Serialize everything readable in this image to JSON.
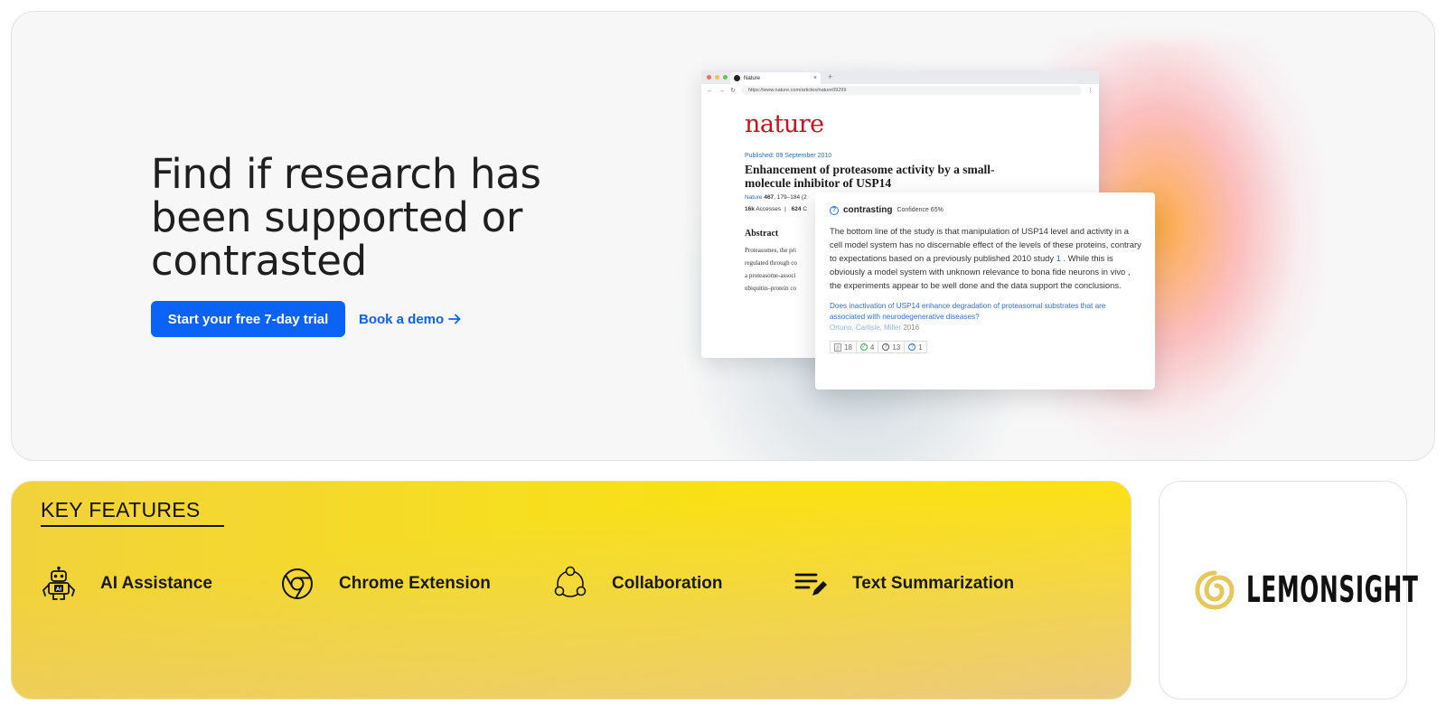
{
  "hero": {
    "title": "Find if research has been supported or contrasted",
    "cta_primary": "Start your free 7-day trial",
    "cta_secondary": "Book a demo"
  },
  "browser": {
    "tab_title": "Nature",
    "url": "https://www.nature.com/articles/nature09299",
    "logo": "nature",
    "published": "Published: 09 September 2010",
    "article_title": "Enhancement of proteasome activity by a small-molecule inhibitor of USP14",
    "meta_journal": "Nature",
    "meta_volume": "467",
    "meta_pages": ", 179–184 (2",
    "meta_accesses_count": "16k",
    "meta_accesses_label": "Accesses",
    "meta_citations": "624",
    "meta_citations_tail": "C",
    "abstract_heading": "Abstract",
    "abstract_lines": [
      "Proteasomes, the pri",
      "regulated through co",
      "a proteasome-associ",
      "ubiquitin–protein co"
    ]
  },
  "popup": {
    "label": "contrasting",
    "confidence": "Confidence 65%",
    "body_before_ref": "The bottom line of the study is that manipulation of USP14 level and activity in a cell model system has no discernable effect of the levels of these proteins, contrary to expectations based on a previously published 2010 study ",
    "ref": "1",
    "body_after_ref": " . While this is obviously a model system with unknown relevance to bona fide neurons in vivo , the experiments appear to be well done and the data support the conclusions.",
    "question": "Does inactivation of USP14 enhance degradation of proteasomal substrates that are associated with neurodegenerative diseases?",
    "authors": "Ortuno, Carlisle, Miller",
    "year": "2016",
    "stats": {
      "total": "18",
      "supporting": "4",
      "mentioning": "13",
      "contrasting": "1"
    }
  },
  "features": {
    "heading": "KEY FEATURES",
    "items": [
      {
        "label": "AI Assistance",
        "icon": "robot-icon"
      },
      {
        "label": "Chrome Extension",
        "icon": "chrome-icon"
      },
      {
        "label": "Collaboration",
        "icon": "collaboration-icon"
      },
      {
        "label": "Text Summarization",
        "icon": "text-summarization-icon"
      }
    ]
  },
  "brand": {
    "name": "LEMONSIGHT",
    "logo_color": "#e7c65a"
  },
  "colors": {
    "primary": "#0b63f5",
    "nature_red": "#c4121f",
    "feature_yellow": "#ffe600"
  }
}
